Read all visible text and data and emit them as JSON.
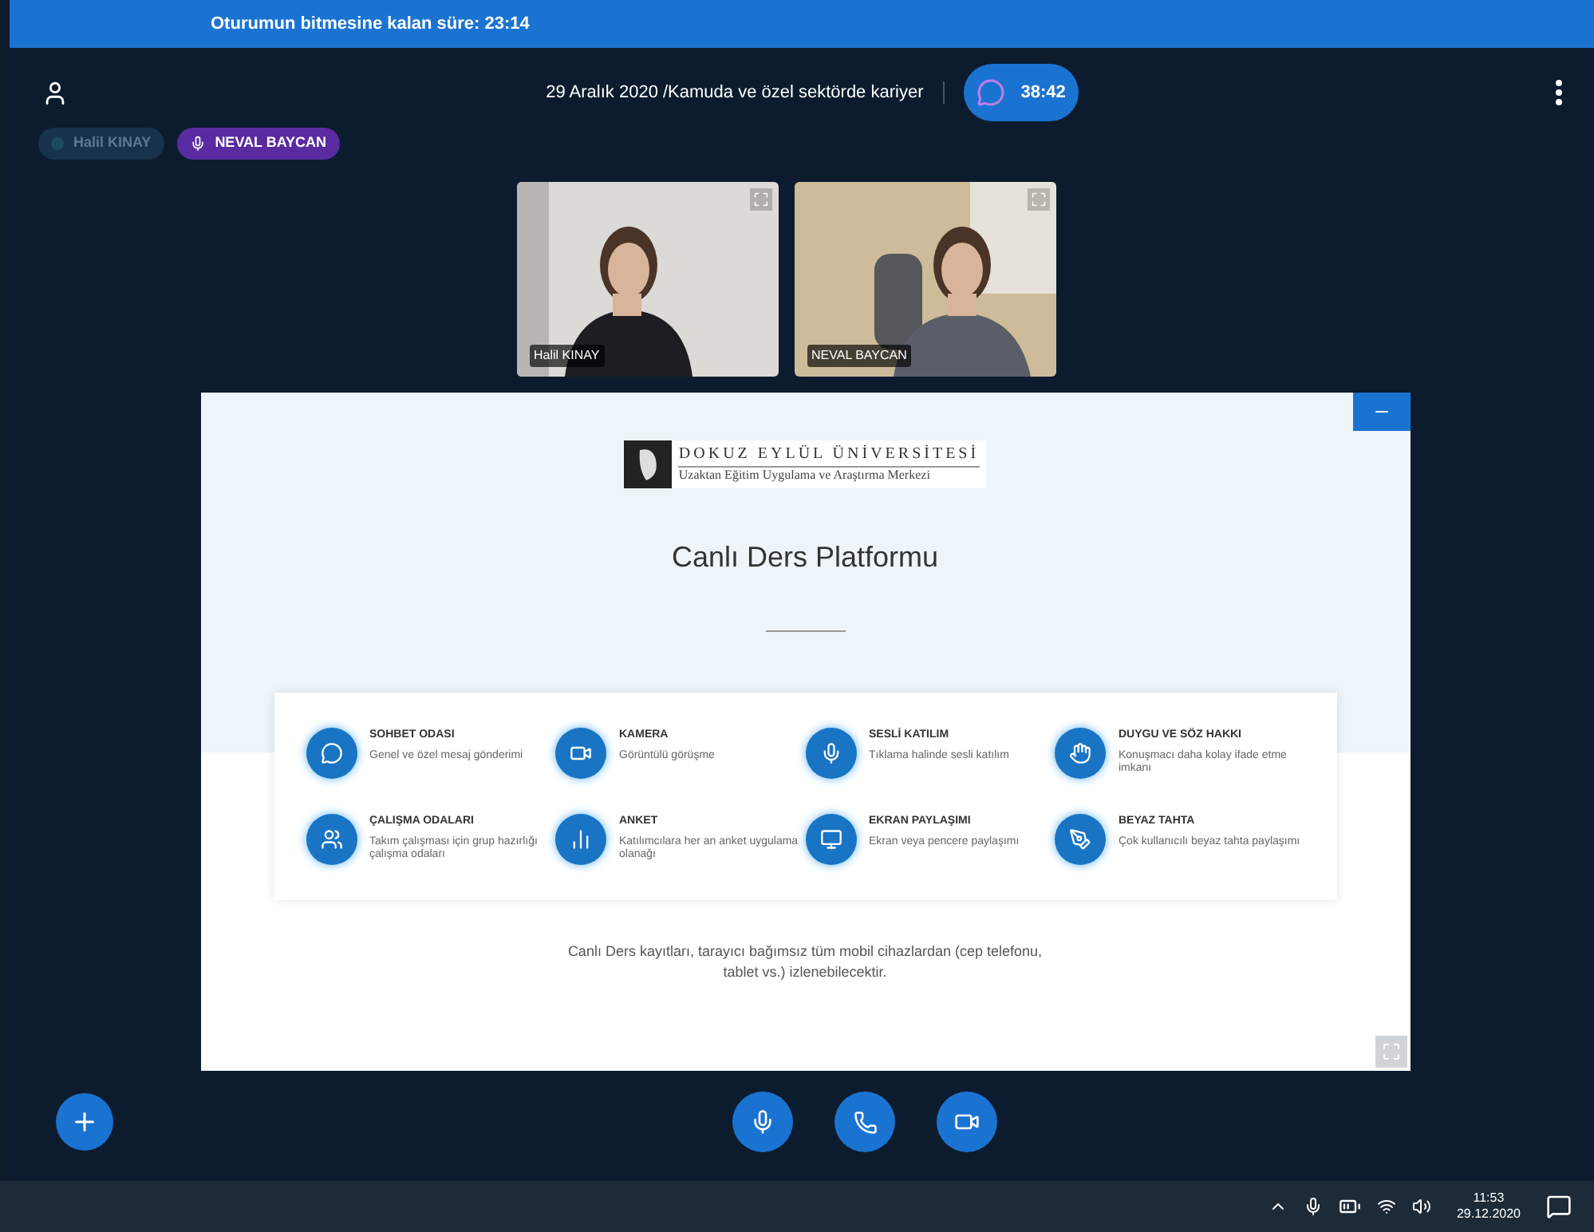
{
  "session_banner": {
    "text": "Oturumun bitmesine kalan süre: 23:14"
  },
  "header": {
    "title": "29 Aralık 2020 /Kamuda ve özel sektörde kariyer",
    "timer": "38:42"
  },
  "talkers": [
    {
      "name": "Halil KINAY",
      "talking": false
    },
    {
      "name": "NEVAL BAYCAN",
      "talking": true
    }
  ],
  "videos": [
    {
      "name": "Halil KINAY"
    },
    {
      "name": "NEVAL BAYCAN"
    }
  ],
  "slide": {
    "logo_line_1": "DOKUZ EYLÜL ÜNİVERSİTESİ",
    "logo_line_2": "Uzaktan Eğitim Uygulama ve Araştırma Merkezi",
    "title": "Canlı Ders Platformu",
    "features": [
      {
        "title": "SOHBET ODASI",
        "text": "Genel ve özel mesaj gönderimi"
      },
      {
        "title": "KAMERA",
        "text": "Görüntülü görüşme"
      },
      {
        "title": "SESLİ KATILIM",
        "text": "Tıklama halinde sesli katılım"
      },
      {
        "title": "DUYGU VE SÖZ HAKKI",
        "text": "Konuşmacı daha kolay ifade etme imkanı"
      },
      {
        "title": "ÇALIŞMA ODALARI",
        "text": "Takım çalışması için grup hazırlığı çalışma odaları"
      },
      {
        "title": "ANKET",
        "text": "Katılımcılara her an anket uygulama olanağı"
      },
      {
        "title": "EKRAN PAYLAŞIMI",
        "text": "Ekran veya pencere paylaşımı"
      },
      {
        "title": "BEYAZ TAHTA",
        "text": "Çok kullanıcılı beyaz tahta paylaşımı"
      }
    ],
    "footer": "Canlı Ders kayıtları, tarayıcı bağımsız tüm mobil cihazlardan (cep telefonu, tablet vs.) izlenebilecektir."
  },
  "taskbar": {
    "time": "11:53",
    "date": "29.12.2020"
  }
}
